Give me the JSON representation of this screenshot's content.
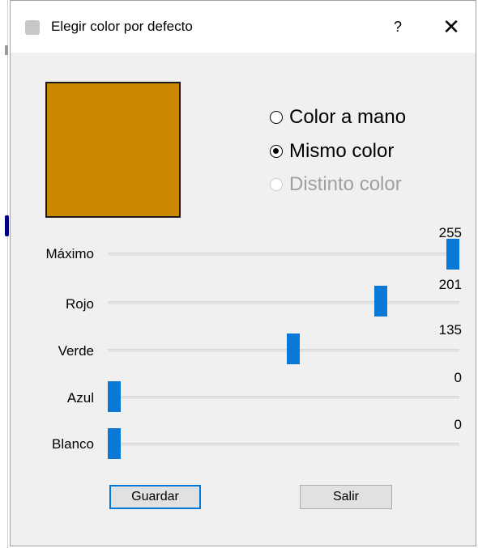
{
  "window": {
    "title": "Elegir color por defecto",
    "help_label": "?",
    "close_label": "✕"
  },
  "swatch": {
    "color": "#cc8700"
  },
  "radio_options": [
    {
      "label": "Color a mano",
      "checked": false,
      "enabled": true
    },
    {
      "label": "Mismo color",
      "checked": true,
      "enabled": true
    },
    {
      "label": "Distinto color",
      "checked": false,
      "enabled": false
    }
  ],
  "sliders": [
    {
      "label": "Máximo",
      "value": "255",
      "min": 0,
      "max": 255
    },
    {
      "label": "Rojo",
      "value": "201",
      "min": 0,
      "max": 255
    },
    {
      "label": "Verde",
      "value": "135",
      "min": 0,
      "max": 255
    },
    {
      "label": "Azul",
      "value": "0",
      "min": 0,
      "max": 255
    },
    {
      "label": "Blanco",
      "value": "0",
      "min": 0,
      "max": 255
    }
  ],
  "buttons": {
    "save_label": "Guardar",
    "exit_label": "Salir"
  },
  "colors": {
    "accent": "#0078d7",
    "thumb": "#0a78d7",
    "dialog_bg": "#f0f0f0"
  }
}
